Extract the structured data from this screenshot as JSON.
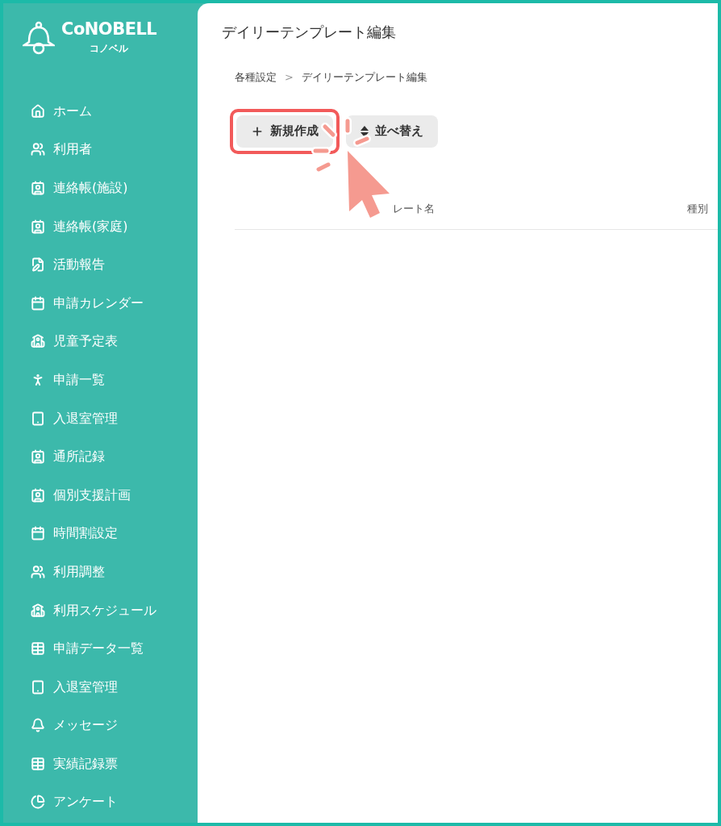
{
  "logo": {
    "name": "CoNOBELL",
    "subtitle": "コノベル"
  },
  "sidebar": {
    "items": [
      {
        "label": "ホーム"
      },
      {
        "label": "利用者"
      },
      {
        "label": "連絡帳(施設)"
      },
      {
        "label": "連絡帳(家庭)"
      },
      {
        "label": "活動報告"
      },
      {
        "label": "申請カレンダー"
      },
      {
        "label": "児童予定表"
      },
      {
        "label": "申請一覧"
      },
      {
        "label": "入退室管理"
      },
      {
        "label": "通所記録"
      },
      {
        "label": "個別支援計画"
      },
      {
        "label": "時間割設定"
      },
      {
        "label": "利用調整"
      },
      {
        "label": "利用スケジュール"
      },
      {
        "label": "申請データ一覧"
      },
      {
        "label": "入退室管理"
      },
      {
        "label": "メッセージ"
      },
      {
        "label": "実績記録票"
      },
      {
        "label": "アンケート"
      }
    ]
  },
  "page": {
    "title": "デイリーテンプレート編集",
    "breadcrumb": [
      "各種設定",
      "デイリーテンプレート編集"
    ],
    "breadcrumb_separator": ">"
  },
  "toolbar": {
    "buttons": [
      {
        "label": "新規作成",
        "highlighted": true
      },
      {
        "label": "並べ替え",
        "highlighted": false
      }
    ]
  },
  "table": {
    "columns": [
      "レート名",
      "種別"
    ]
  }
}
